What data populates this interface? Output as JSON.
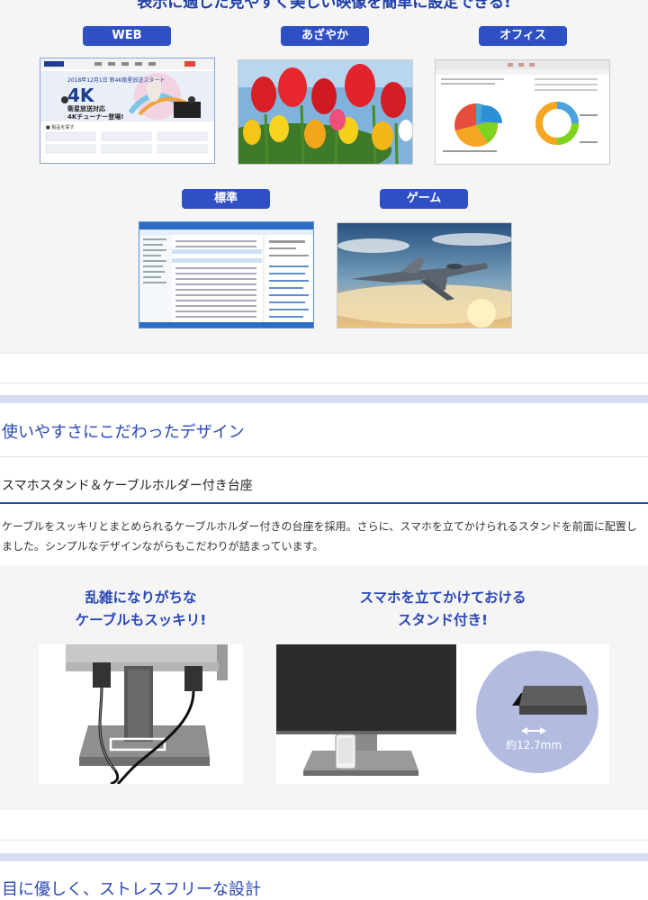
{
  "modes": {
    "title": "表示に適した見やすく美しい映像を簡単に設定できる!",
    "items": [
      {
        "label": "WEB"
      },
      {
        "label": "あざやか"
      },
      {
        "label": "オフィス"
      },
      {
        "label": "標準"
      },
      {
        "label": "ゲーム"
      }
    ]
  },
  "design": {
    "section_title": "使いやすさにこだわったデザイン",
    "subsection_title": "スマホスタンド＆ケーブルホルダー付き台座",
    "description": "ケーブルをスッキリとまとめられるケーブルホルダー付きの台座を採用。さらに、スマホを立てかけられるスタンドを前面に配置しました。シンプルなデザインながらもこだわりが詰まっています。",
    "features": [
      {
        "line1": "乱雑になりがちな",
        "line2": "ケーブルもスッキリ!"
      },
      {
        "line1": "スマホを立てかけておける",
        "line2": "スタンド付き!"
      }
    ],
    "stand_width_label": "約12.7mm"
  },
  "next_section_title": "目に優しく、ストレスフリーな設計",
  "colors": {
    "accent": "#2a47b9",
    "pill": "#2f4fc4",
    "band": "#d9ddf3"
  },
  "icons": [
    "double-arrow-icon"
  ]
}
